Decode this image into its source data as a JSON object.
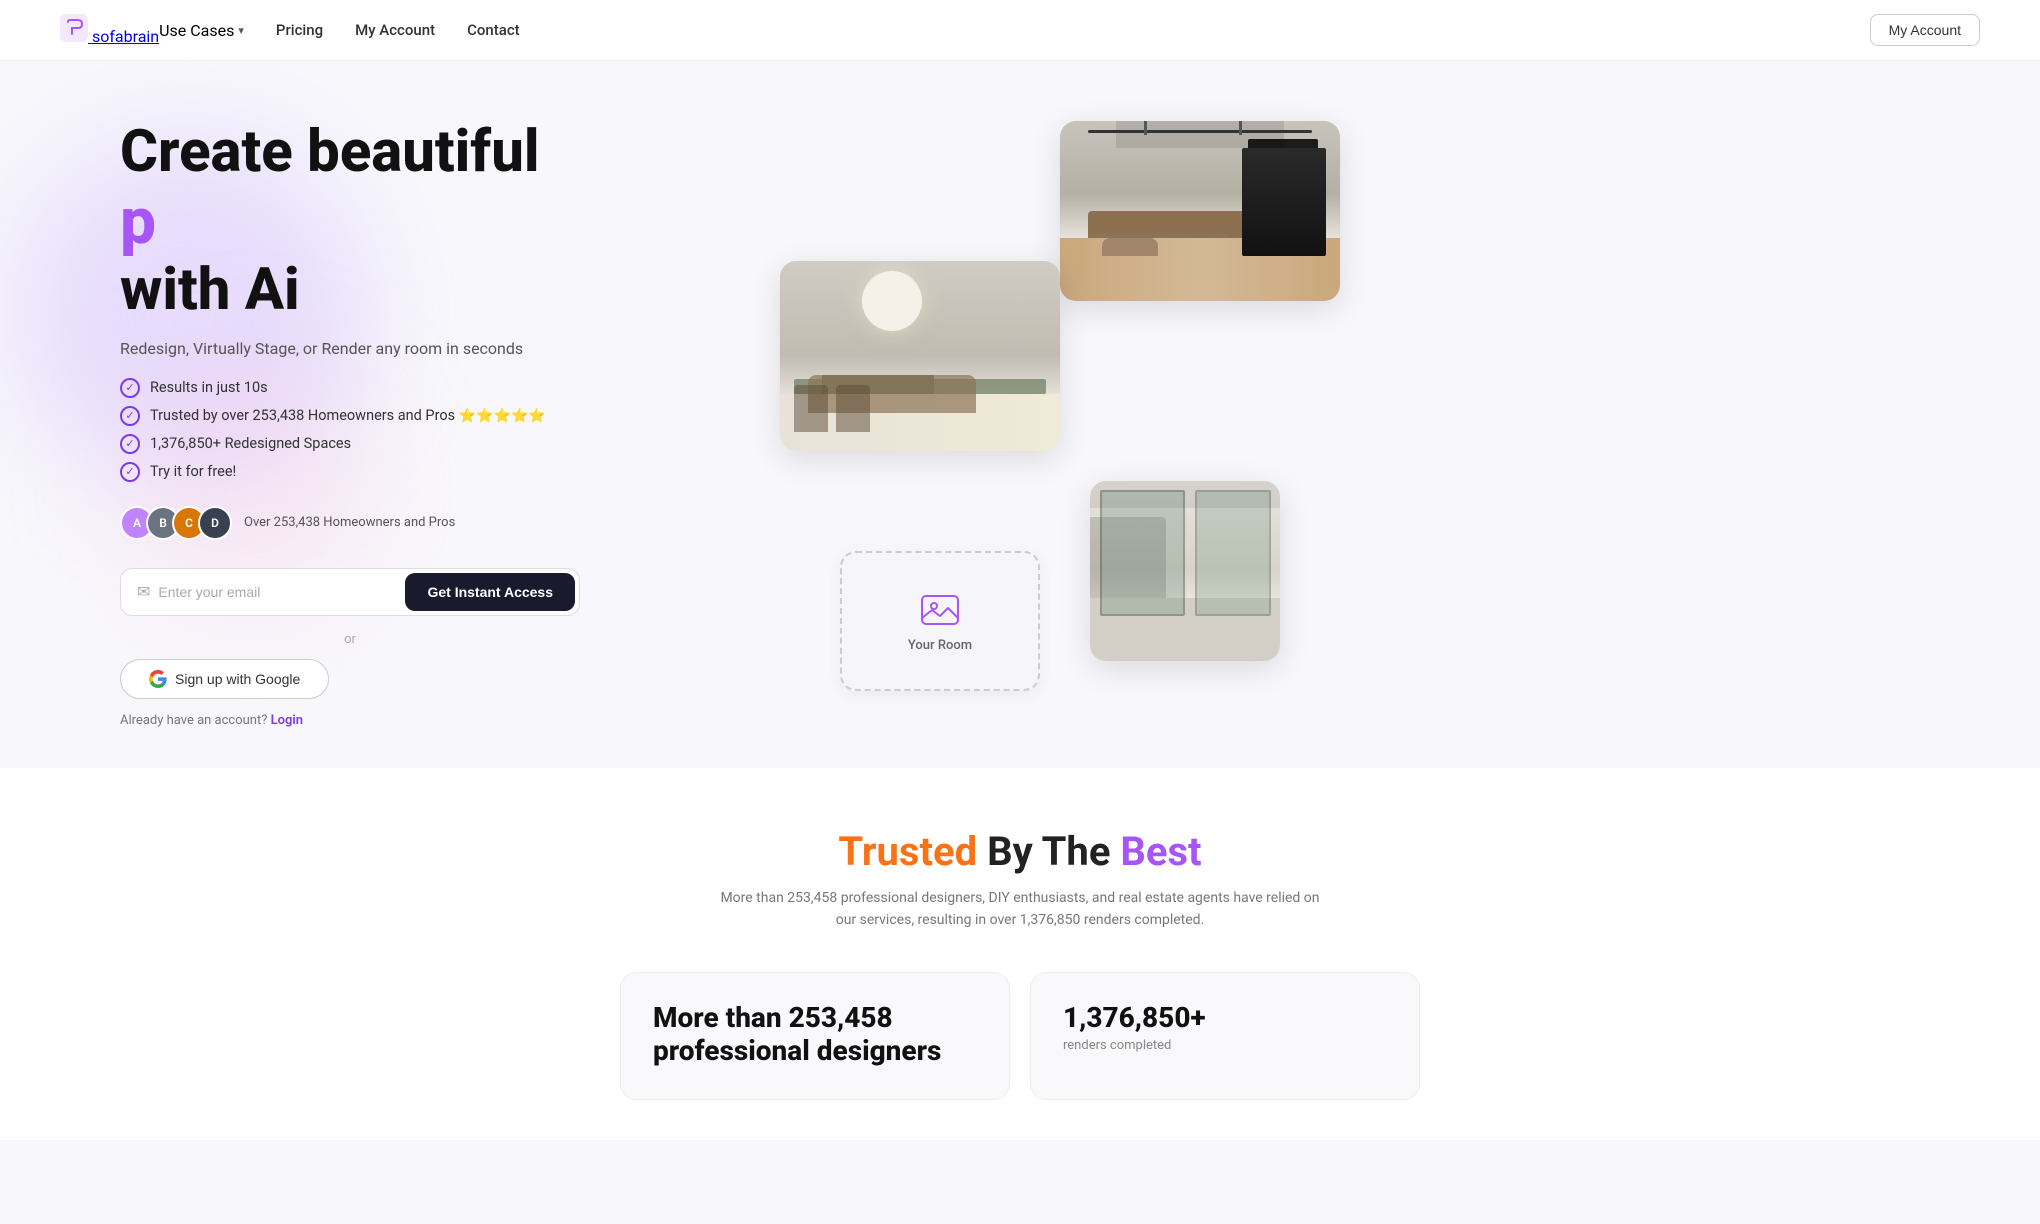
{
  "nav": {
    "logo_text": "sofabrain",
    "links": [
      {
        "id": "use-cases",
        "label": "Use Cases",
        "has_dropdown": true
      },
      {
        "id": "pricing",
        "label": "Pricing"
      },
      {
        "id": "my-account-link",
        "label": "My Account"
      },
      {
        "id": "contact",
        "label": "Contact"
      }
    ],
    "cta_button": "My Account"
  },
  "hero": {
    "title_line1": "Create beautiful",
    "title_letter": "p",
    "title_line2": "with Ai",
    "subtitle": "Redesign, Virtually Stage, or Render any room in seconds",
    "features": [
      {
        "text": "Results in just 10s"
      },
      {
        "text": "Trusted by over 253,438 Homeowners and Pros ⭐⭐⭐⭐⭐"
      },
      {
        "text": "1,376,850+ Redesigned Spaces"
      },
      {
        "text": "Try it for free!"
      }
    ],
    "social_proof_text": "Over 253,438 Homeowners and Pros",
    "email_placeholder": "Enter your email",
    "cta_button": "Get Instant Access",
    "divider": "or",
    "google_button": "Sign up with Google",
    "login_text": "Already have an account?",
    "login_link": "Login",
    "your_room_label": "Your Room"
  },
  "trusted_section": {
    "title_part1": "Trusted",
    "title_part2": " By The ",
    "title_part3": "Best",
    "subtitle": "More than 253,458 professional designers, DIY enthusiasts, and real estate agents have relied on our services, resulting in over 1,376,850 renders completed.",
    "stats": [
      {
        "number": "More than 253,458 professional designers",
        "label": ""
      },
      {
        "number": "1,376,850+",
        "label": "renders completed"
      }
    ],
    "stat1_label": "More than 253,458 professional designers"
  }
}
